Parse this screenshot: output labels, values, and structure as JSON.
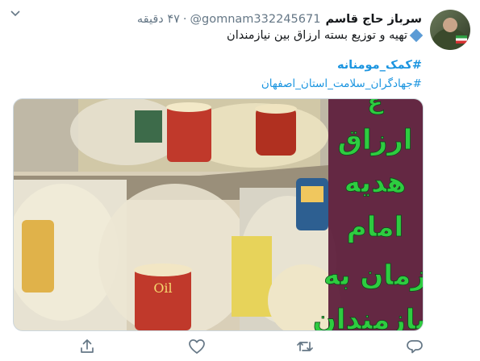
{
  "tweet": {
    "display_name": "سرباز حاج قاسم",
    "handle": "@gomnam332245671",
    "separator": "·",
    "time": "۴۷ دقیقه",
    "text_line": "تهیه و توزیع بسته ارزاق بین نیازمندان",
    "hashtag_1": "#کمک_مومنانه",
    "hashtag_2": "#جهادگران_سلامت_استان_اصفهان"
  },
  "media": {
    "overlay_words": [
      "ارزاق",
      "هدیه",
      "امام",
      "زمان به",
      "نیازمندان"
    ],
    "cup_label": "Oil"
  },
  "actions": [
    "reply-icon",
    "retweet-icon",
    "like-icon",
    "share-icon"
  ],
  "colors": {
    "link": "#1b95e0",
    "secondary_text": "#657786",
    "overlay_green": "#2ecc40",
    "overlay_bg": "#5a1a38"
  }
}
